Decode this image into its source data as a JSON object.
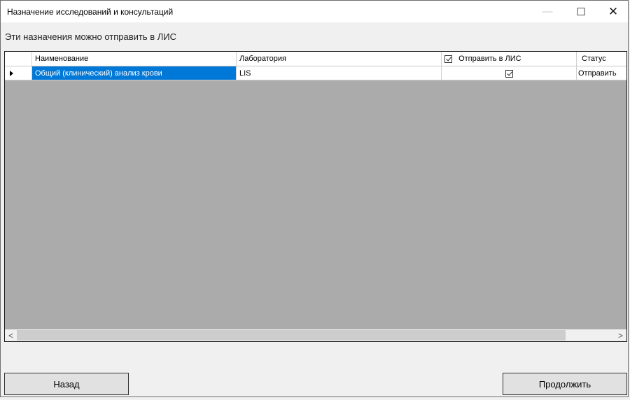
{
  "window": {
    "title": "Назначение исследований и консультаций",
    "controls": {
      "minimize": "—",
      "maximize": "☐",
      "close": "✕"
    }
  },
  "subtitle": "Эти назначения можно отправить в ЛИС",
  "grid": {
    "columns": [
      {
        "key": "name",
        "label": "Наименование"
      },
      {
        "key": "lab",
        "label": "Лаборатория"
      },
      {
        "key": "send",
        "label": "Отправить в ЛИС",
        "header_checked": true
      },
      {
        "key": "status",
        "label": "Статус"
      }
    ],
    "rows": [
      {
        "name": "Общий (клинический) анализ крови",
        "lab": "LIS",
        "send": true,
        "status": "Отправить",
        "selected": true
      }
    ]
  },
  "scrollbar": {
    "left_arrow": "<",
    "right_arrow": ">"
  },
  "buttons": {
    "back": "Назад",
    "continue": "Продолжить"
  }
}
